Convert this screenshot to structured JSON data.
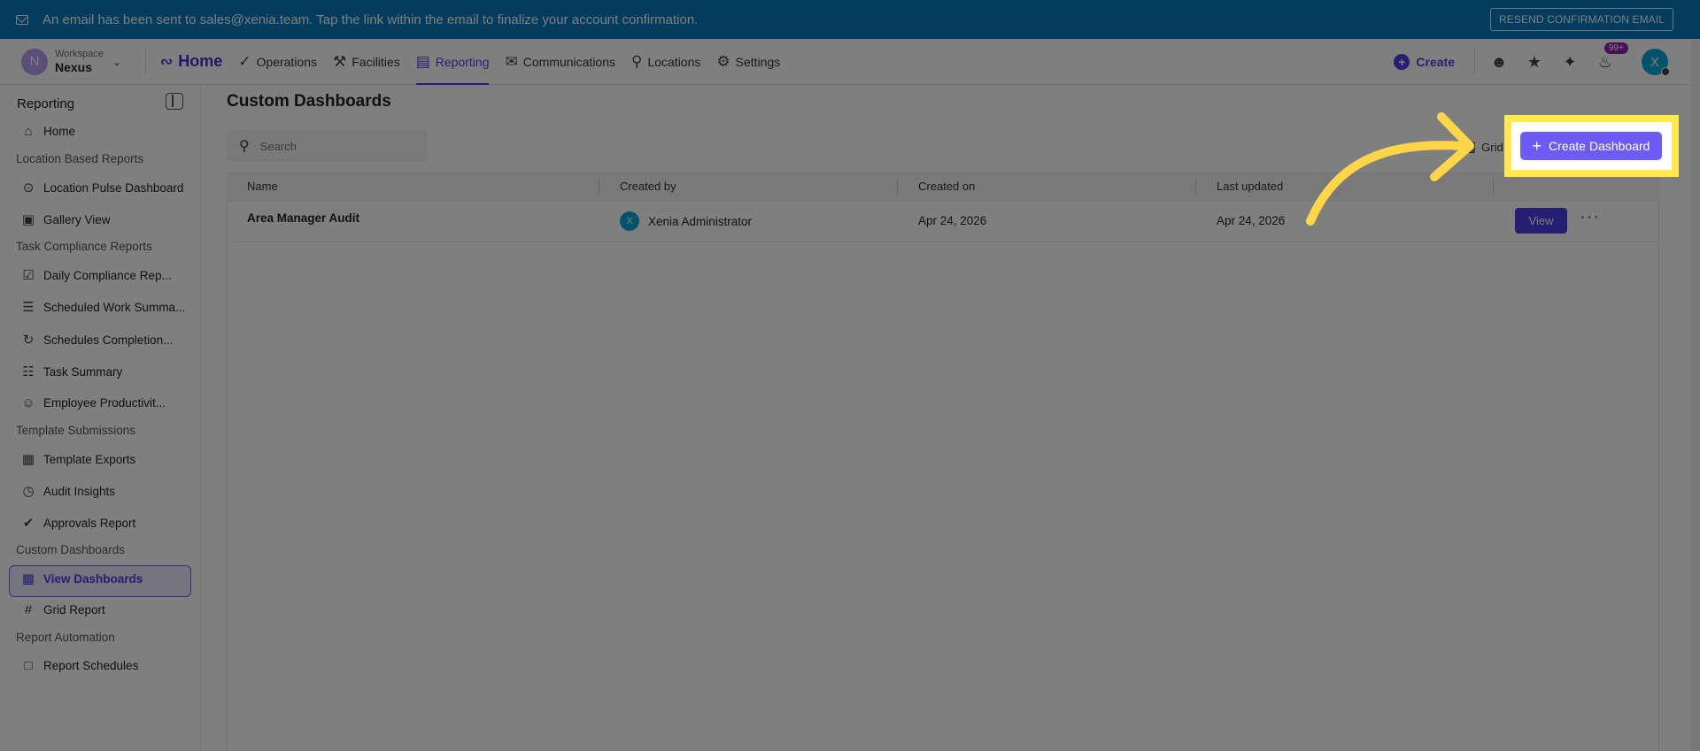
{
  "banner": {
    "message": "An email has been sent to sales@xenia.team. Tap the link within the email to finalize your account confirmation.",
    "resend_label": "RESEND CONFIRMATION EMAIL"
  },
  "workspace": {
    "initial": "N",
    "label": "Workspace",
    "name": "Nexus"
  },
  "nav": {
    "home": "Home",
    "items": [
      "Operations",
      "Facilities",
      "Reporting",
      "Communications",
      "Locations",
      "Settings"
    ],
    "create_label": "Create",
    "notification_badge": "99+",
    "user_initial": "X"
  },
  "sidebar": {
    "title": "Reporting",
    "home": "Home",
    "sections": {
      "location": "Location Based Reports",
      "task": "Task Compliance Reports",
      "template": "Template Submissions",
      "custom": "Custom Dashboards",
      "automation": "Report Automation"
    },
    "items": {
      "location_pulse": "Location Pulse Dashboard",
      "gallery": "Gallery View",
      "daily": "Daily Compliance Rep...",
      "scheduled": "Scheduled Work Summa...",
      "schedules_completion": "Schedules Completion...",
      "task_summary": "Task Summary",
      "employee": "Employee Productivit...",
      "template_exports": "Template Exports",
      "audit": "Audit Insights",
      "approvals": "Approvals Report",
      "view_dashboards": "View Dashboards",
      "grid_report": "Grid Report",
      "report_schedules": "Report Schedules"
    }
  },
  "main": {
    "title": "Custom Dashboards",
    "search_placeholder": "Search",
    "grid_label": "Grid",
    "create_dashboard": "Create Dashboard",
    "columns": [
      "Name",
      "Created by",
      "Created on",
      "Last updated"
    ],
    "rows": [
      {
        "name": "Area Manager Audit",
        "creator_initial": "X",
        "created_by": "Xenia Administrator",
        "created_on": "Apr 24, 2026",
        "last_updated": "Apr 24, 2026",
        "action": "View",
        "more": "···"
      }
    ]
  },
  "colors": {
    "banner": "#0277bd",
    "accent": "#4b3fe5",
    "button": "#6c5bf5",
    "highlight": "#ffe94e",
    "avatar": "#0aa6d6"
  }
}
